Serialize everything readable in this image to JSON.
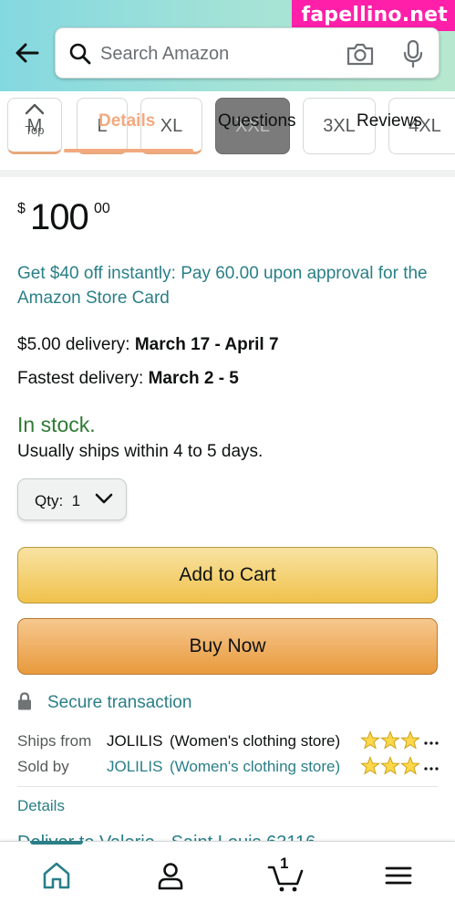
{
  "watermark": "fapellino.net",
  "search": {
    "placeholder": "Search Amazon"
  },
  "sticky_tabs": {
    "top_label": "Top",
    "tabs": [
      "Details",
      "Questions",
      "Reviews"
    ],
    "active_tab": "Details"
  },
  "sizes": [
    "M",
    "L",
    "XL",
    "XXL",
    "3XL",
    "4XL"
  ],
  "selected_size": "XXL",
  "price": {
    "symbol": "$",
    "whole": "100",
    "fraction": "00"
  },
  "promo": "Get $40 off instantly: Pay 60.00 upon approval for the Amazon Store Card",
  "delivery": {
    "prefix": "$5.00 delivery: ",
    "dates": "March 17 - April 7"
  },
  "fastest": {
    "prefix": "Fastest delivery: ",
    "dates": "March 2 - 5"
  },
  "stock": "In stock.",
  "ships_within": "Usually ships within 4 to 5 days.",
  "qty": {
    "label": "Qty:",
    "value": "1"
  },
  "buttons": {
    "add_to_cart": "Add to Cart",
    "buy_now": "Buy Now"
  },
  "secure": "Secure transaction",
  "ships_from": {
    "label": "Ships from",
    "seller": "JOLILIS",
    "store": "(Women's clothing store)",
    "rating_stars": 3
  },
  "sold_by": {
    "label": "Sold by",
    "seller": "JOLILIS",
    "store": "(Women's clothing store)",
    "rating_stars": 3
  },
  "details_link": "Details",
  "deliver_to": "Deliver to Valerie - Saint Louis 63116",
  "bottom_nav": {
    "cart_count": "1",
    "active": "home"
  },
  "colors": {
    "teal_link": "#2a7f87",
    "in_stock": "#2f7a34",
    "accent_orange": "#f2a97f",
    "watermark_pink": "#ff1fa9"
  }
}
